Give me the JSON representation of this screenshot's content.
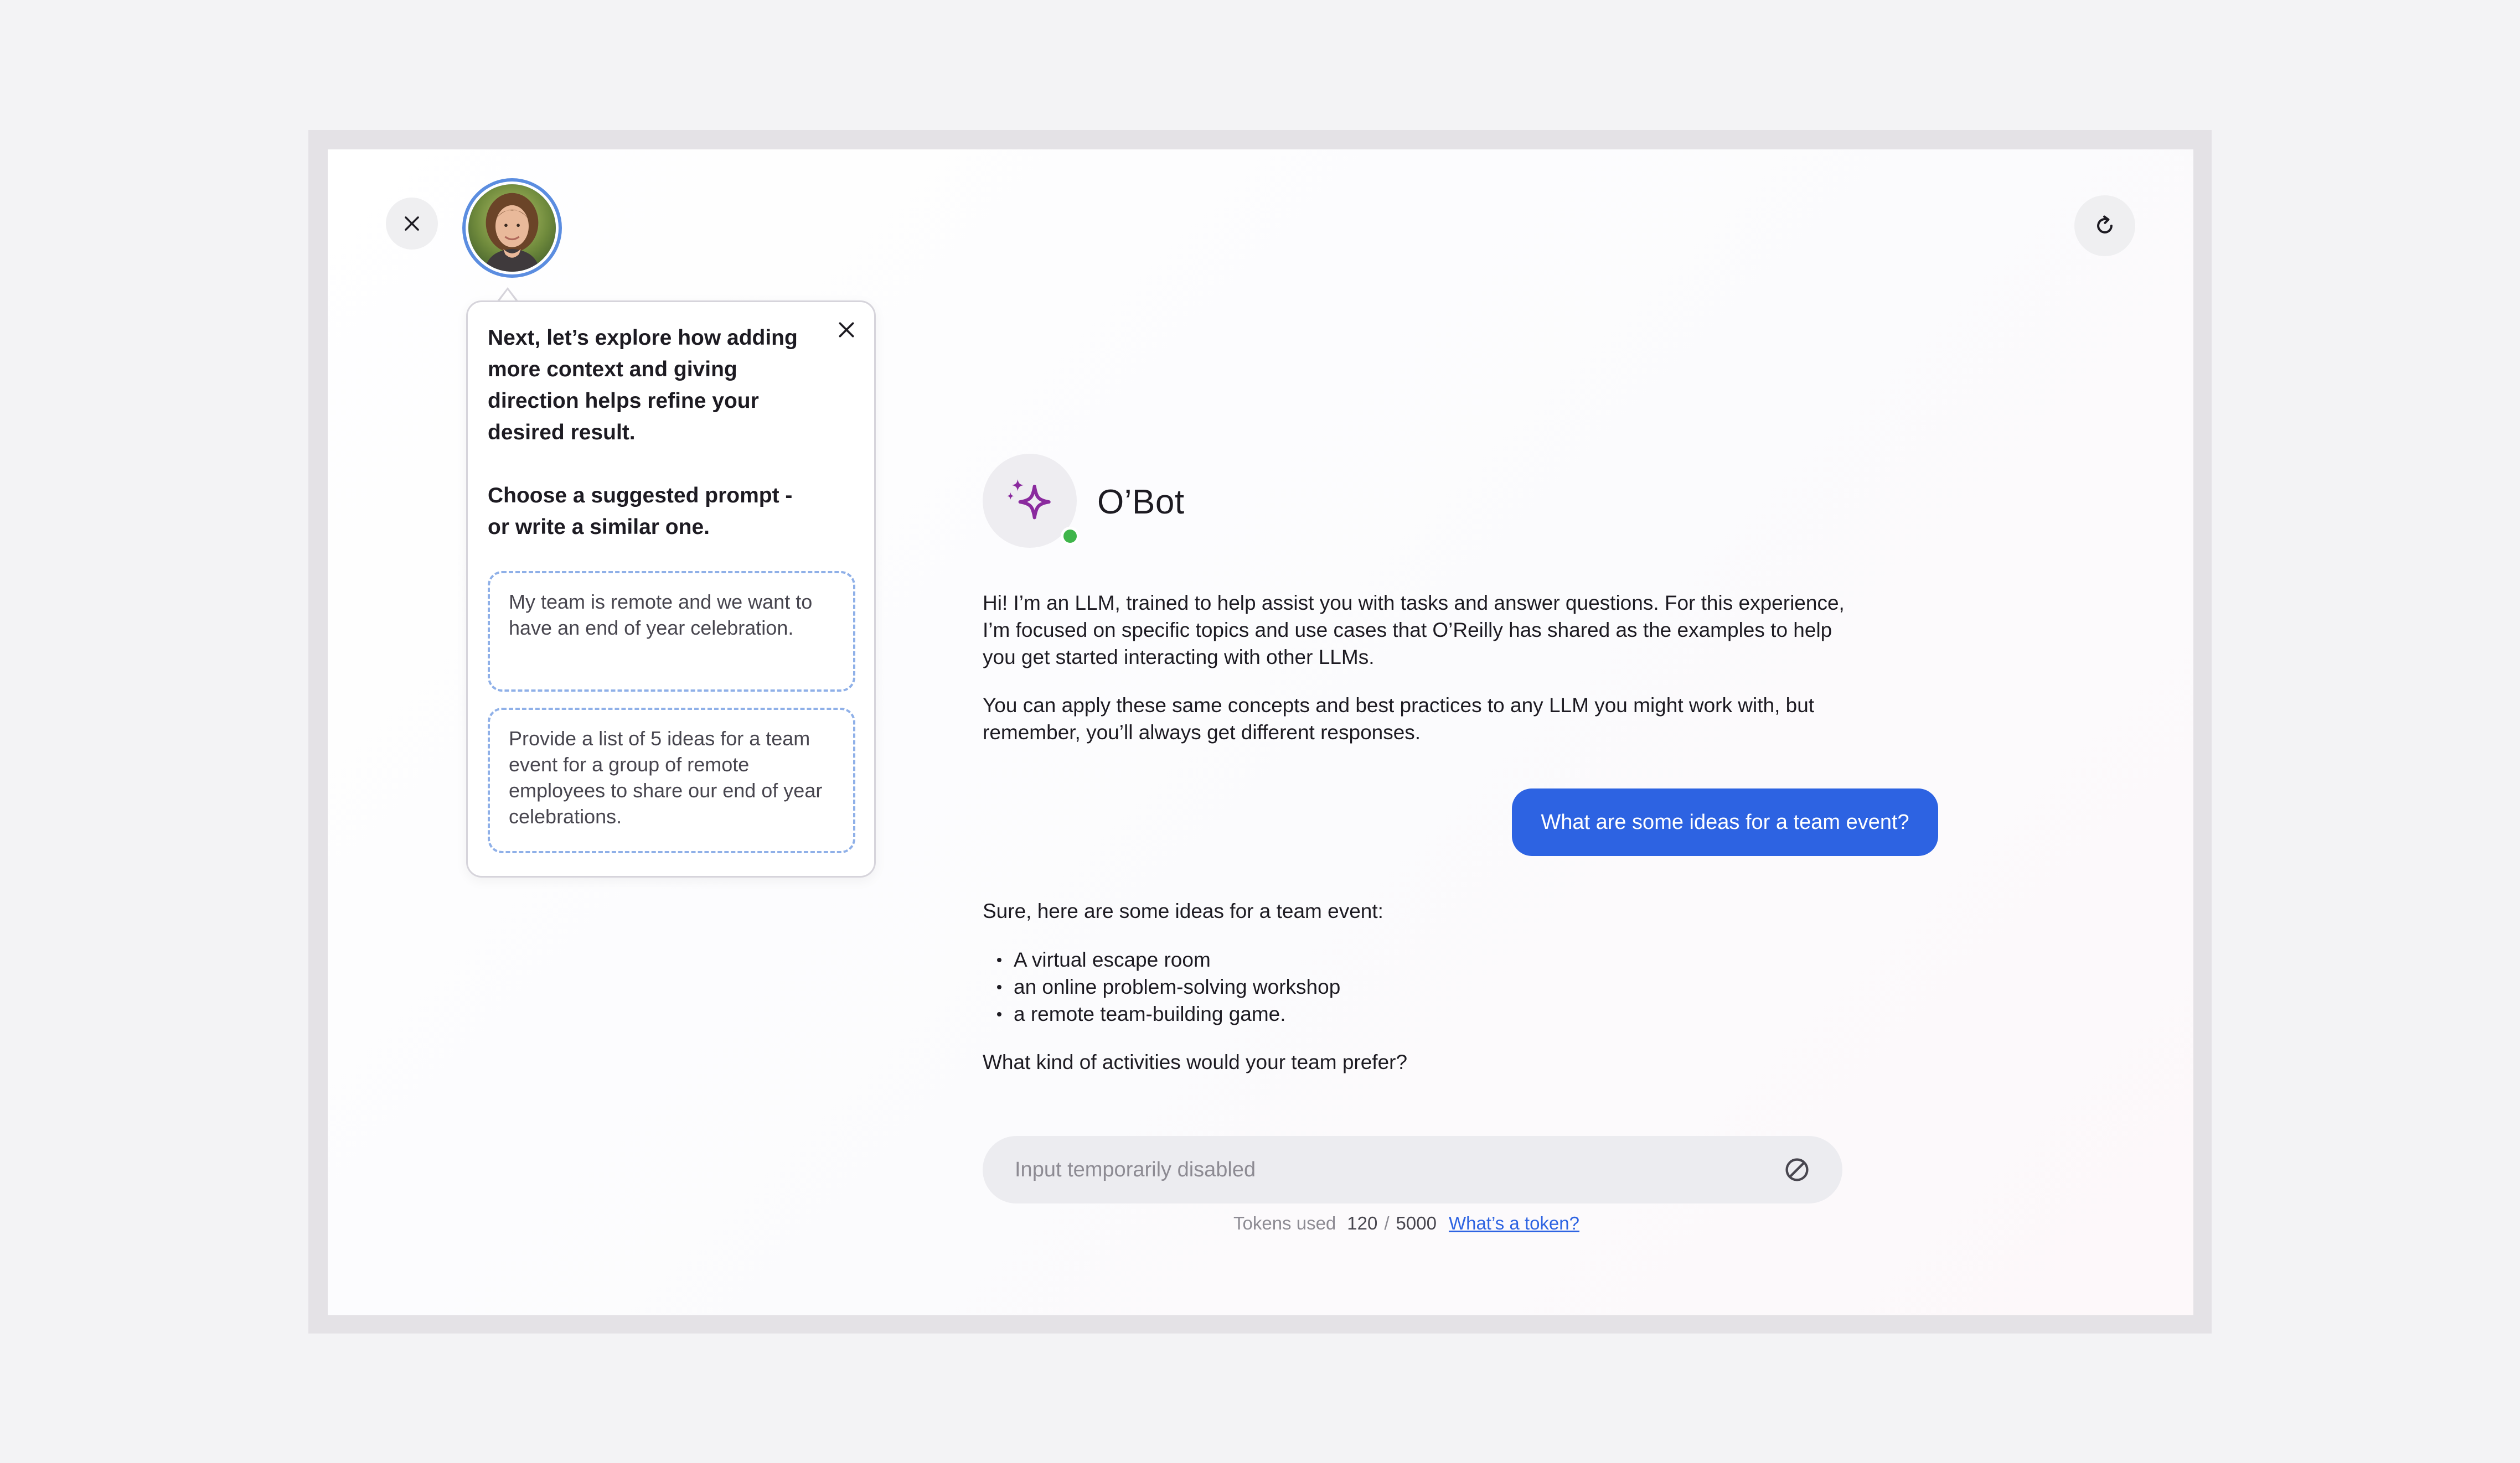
{
  "header": {
    "close_icon": "close-icon",
    "avatar_alt": "guide-avatar",
    "refresh_icon": "refresh-icon"
  },
  "tooltip": {
    "text_1": "Next, let’s explore how adding more context and giving direction helps refine your desired result.",
    "text_2": "Choose a suggested prompt - or write a similar one.",
    "suggestions": [
      "My team is remote and we want to have an end of year celebration.",
      "Provide a list of 5 ideas for a team event for a group of remote employees to share our end of year celebrations."
    ]
  },
  "bot": {
    "name": "O’Bot",
    "status_color": "#3fb54a",
    "icon": "sparkle-icon",
    "intro_1": "Hi! I’m an LLM, trained to help assist you with tasks and answer questions. For this experience, I’m focused on specific topics and use cases that O’Reilly has shared as the examples to help you get started interacting with other LLMs.",
    "intro_2": "You can apply these same concepts and best practices to any LLM you might work with, but remember, you’ll always get different responses."
  },
  "chat": {
    "user_message": "What are some ideas for a team event?",
    "reply_intro": "Sure, here are some ideas for a team event:",
    "reply_items": [
      "A virtual escape room",
      "an online problem-solving workshop",
      "a remote team-building game."
    ],
    "reply_question": "What kind of activities would your team prefer?"
  },
  "input": {
    "placeholder": "Input temporarily disabled",
    "disabled_icon": "disabled-icon"
  },
  "tokens": {
    "label": "Tokens used",
    "used": "120",
    "separator": "/",
    "limit": "5000",
    "help_link": "What’s a token?"
  },
  "colors": {
    "accent": "#2d63e2",
    "bot_icon": "#8a2a9e",
    "status": "#3fb54a"
  }
}
